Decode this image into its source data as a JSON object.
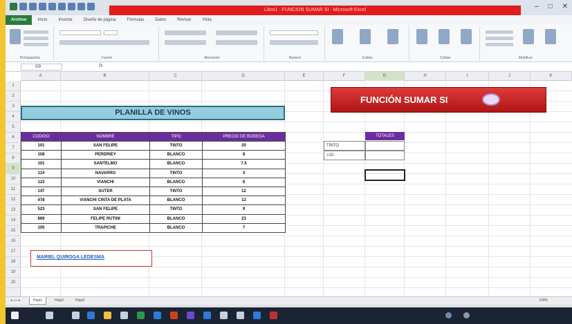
{
  "title_bar": {
    "title": "Libro1 - FUNCION SUMAR SI - Microsoft Excel",
    "minimize": "–",
    "restore": "□",
    "close": "✕"
  },
  "ribbon_tabs": {
    "file": "Archivo",
    "tabs": [
      "Inicio",
      "Insertar",
      "Diseño de página",
      "Fórmulas",
      "Datos",
      "Revisar",
      "Vista"
    ]
  },
  "ribbon_groups": [
    "Portapapeles",
    "Fuente",
    "Alineación",
    "Número",
    "Estilos",
    "Celdas",
    "Modificar"
  ],
  "formula_bar": {
    "name_box": "G9",
    "fx": "fx"
  },
  "columns": [
    "A",
    "B",
    "C",
    "D",
    "E",
    "F",
    "G",
    "H",
    "I",
    "J",
    "K"
  ],
  "rows": [
    "1",
    "2",
    "3",
    "4",
    "5",
    "6",
    "7",
    "8",
    "9",
    "10",
    "11",
    "12",
    "13",
    "14",
    "15",
    "16",
    "17",
    "18",
    "19",
    "20"
  ],
  "sheet": {
    "planilla_title": "PLANILLA DE VINOS",
    "table_headers": [
      "CODIGO",
      "NOMBRE",
      "TIPO",
      "PRECIO DE BODEGA"
    ],
    "table_rows": [
      [
        "101",
        "SAN FELIPE",
        "TINTO",
        "20"
      ],
      [
        "108",
        "PERDRIEY",
        "BLANCO",
        "8"
      ],
      [
        "101",
        "SANTELMO",
        "BLANCO",
        "7.5"
      ],
      [
        "114",
        "NAVARRO",
        "TINTO",
        "4"
      ],
      [
        "123",
        "VIANCHI",
        "BLANCO",
        "6"
      ],
      [
        "147",
        "SUTER",
        "TINTO",
        "12"
      ],
      [
        "478",
        "VIANCHI CINTA DE PLATA",
        "BLANCO",
        "12"
      ],
      [
        "523",
        "SAN FELIPE",
        "TINTO",
        "9"
      ],
      [
        "869",
        "FELIPE RUTINI",
        "BLANCO",
        "23"
      ],
      [
        "105",
        "TRAPICHE",
        "BLANCO",
        "7"
      ]
    ],
    "funcion_title": "FUNCIÓN SUMAR SI",
    "totales_header": "TOTALES",
    "criteria": [
      "TINTO",
      ">10"
    ],
    "author": "MARIEL QUIROGA LEDESMA"
  },
  "sheet_tabs": [
    "Hoja1",
    "Hoja2",
    "Hoja3"
  ],
  "status": {
    "zoom": "100%"
  },
  "colors": {
    "header_purple": "#6c2d9c",
    "title_cyan": "#93cddd",
    "banner_red": "#c62020",
    "excel_green": "#2a7a3d"
  }
}
